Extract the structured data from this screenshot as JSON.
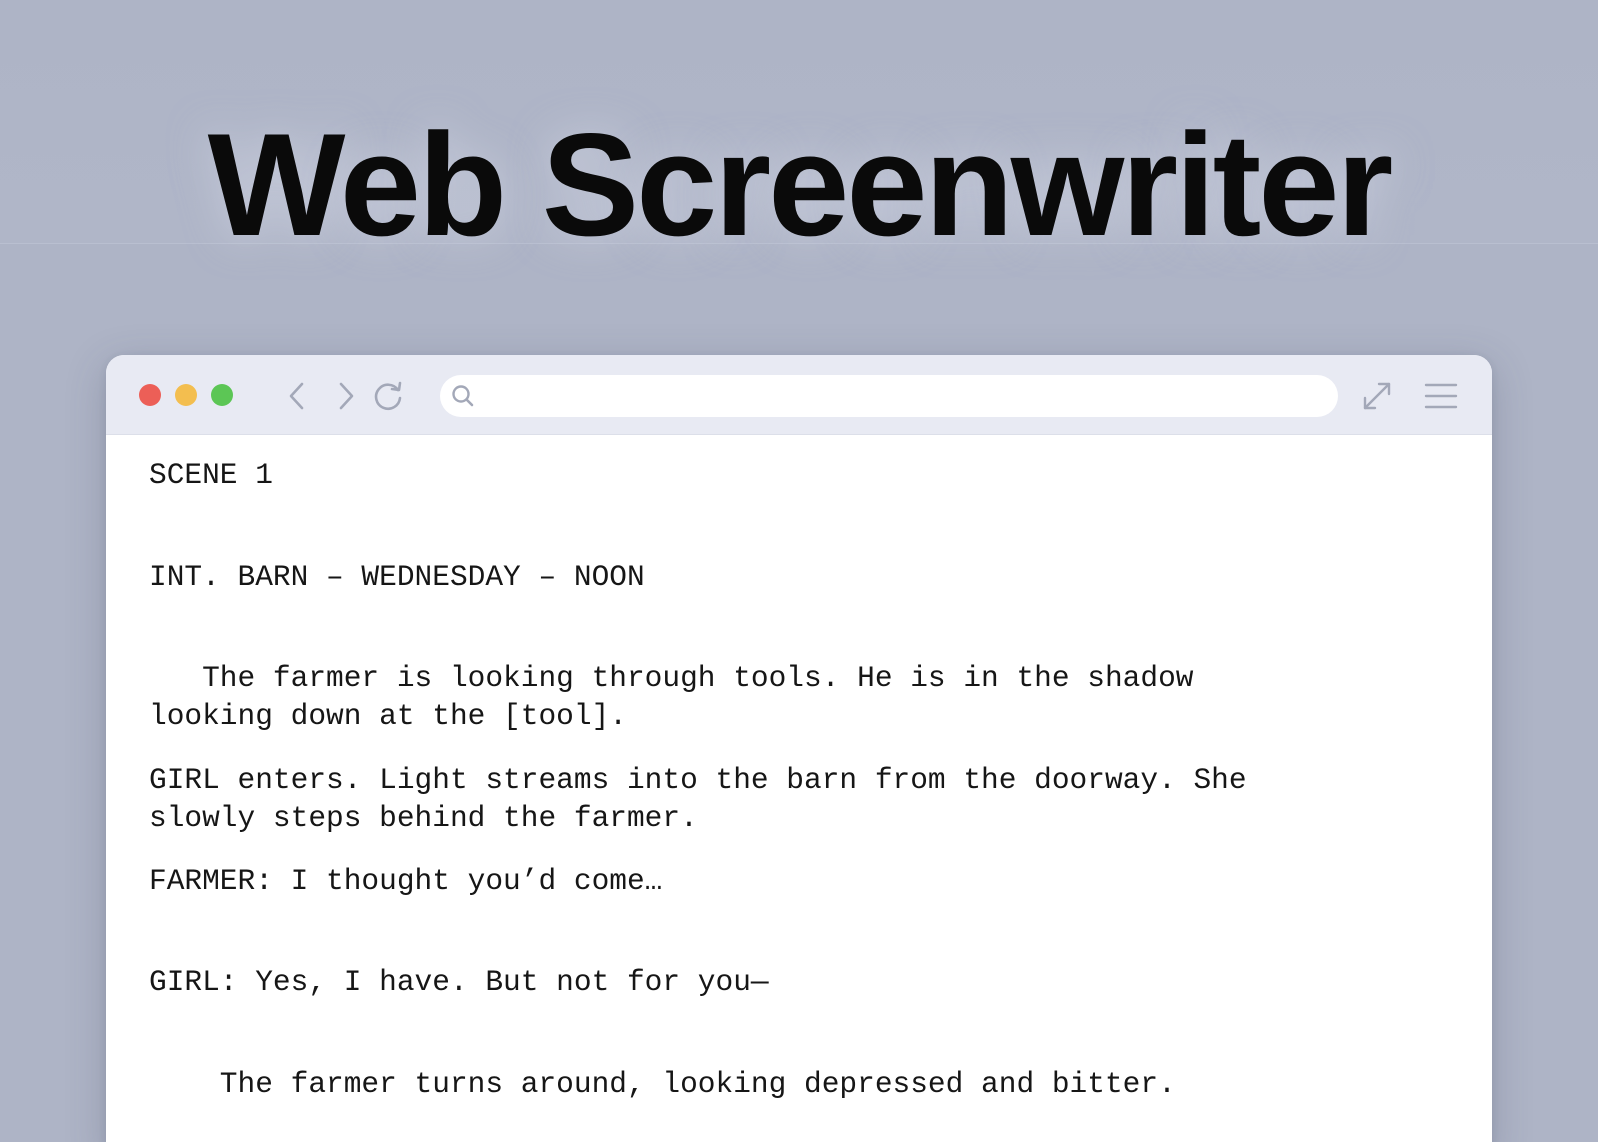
{
  "hero": {
    "title": "Web Screenwriter"
  },
  "browser": {
    "traffic_lights": {
      "close_color": "#ec5f57",
      "minimize_color": "#f3be4f",
      "maximize_color": "#5cc655"
    },
    "toolbar": {
      "back_icon": "chevron-left-icon",
      "forward_icon": "chevron-right-icon",
      "reload_icon": "reload-icon",
      "search_icon": "search-icon",
      "address_value": "",
      "expand_icon": "expand-arrows-icon",
      "menu_icon": "hamburger-menu-icon"
    }
  },
  "script": {
    "scene_number": "SCENE 1",
    "scene_heading": "INT. BARN – WEDNESDAY – NOON",
    "action_1_line_1": "   The farmer is looking through tools. He is in the shadow",
    "action_1_line_2": "looking down at the [tool].",
    "action_2_line_1": "GIRL enters. Light streams into the barn from the doorway. She",
    "action_2_line_2": "slowly steps behind the farmer.",
    "dialogue_1": "FARMER: I thought you’d come…",
    "dialogue_2": "GIRL: Yes, I have. But not for you—",
    "action_3": "    The farmer turns around, looking depressed and bitter."
  },
  "colors": {
    "background": "#aeb4c6",
    "toolbar": "#e8eaf3",
    "icon_gray": "#a3a8b8",
    "text": "#161616"
  }
}
